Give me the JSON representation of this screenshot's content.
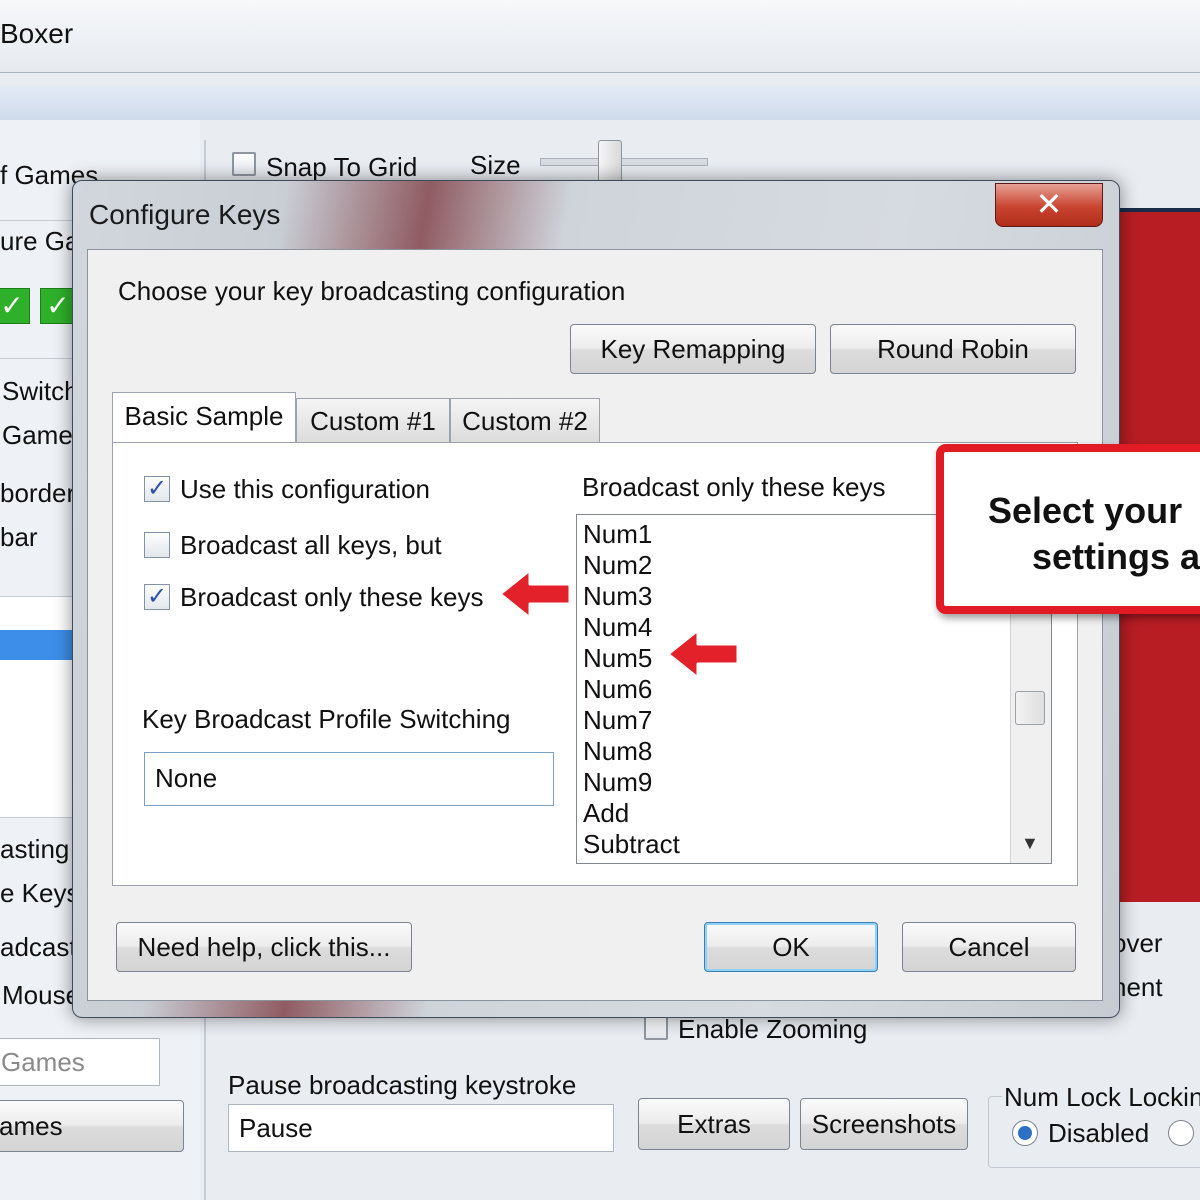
{
  "app": {
    "title": "Boxer",
    "snap_to_grid_label": "Snap To Grid",
    "size_label": "Size",
    "left_items": [
      "f Games",
      "ure Ga",
      "Switch",
      "Game",
      "border",
      "bar",
      "asting",
      "e Keys",
      "adcast",
      "Mouse"
    ],
    "games_field": "Games",
    "games_button": "ames",
    "pause_label": "Pause broadcasting keystroke",
    "pause_value": "Pause",
    "extras_button": "Extras",
    "screenshots_button": "Screenshots",
    "enable_zooming_label": "Enable Zooming",
    "num_lock_label": "Num Lock Locking",
    "disabled_label": "Disabled",
    "right_frag_1": "over",
    "right_frag_2": "nent"
  },
  "dialog": {
    "title": "Configure Keys",
    "close_glyph": "✕",
    "instruction": "Choose your key broadcasting configuration",
    "key_remapping_button": "Key Remapping",
    "round_robin_button": "Round Robin",
    "tabs": [
      {
        "label": "Basic Sample",
        "active": true
      },
      {
        "label": "Custom #1",
        "active": false
      },
      {
        "label": "Custom #2",
        "active": false
      }
    ],
    "use_config_label": "Use this configuration",
    "use_config_checked": true,
    "broadcast_all_label": "Broadcast all keys, but",
    "broadcast_all_checked": false,
    "broadcast_only_label": "Broadcast only these keys",
    "broadcast_only_checked": true,
    "profile_switching_label": "Key Broadcast Profile Switching",
    "profile_switching_value": "None",
    "list_header": "Broadcast only these keys",
    "keys": [
      "Num1",
      "Num2",
      "Num3",
      "Num4",
      "Num5",
      "Num6",
      "Num7",
      "Num8",
      "Num9",
      "Add",
      "Subtract"
    ],
    "help_button": "Need help, click this...",
    "ok_button": "OK",
    "cancel_button": "Cancel"
  },
  "callout": {
    "line1": "Select your",
    "line2": "settings a"
  },
  "colors": {
    "callout_border": "#e01b23",
    "arrow": "#e3212b",
    "red_panel": "#b81d24",
    "check": "#2853a8"
  },
  "icons": {
    "checkmark": "✓",
    "scroll_down": "▼"
  }
}
